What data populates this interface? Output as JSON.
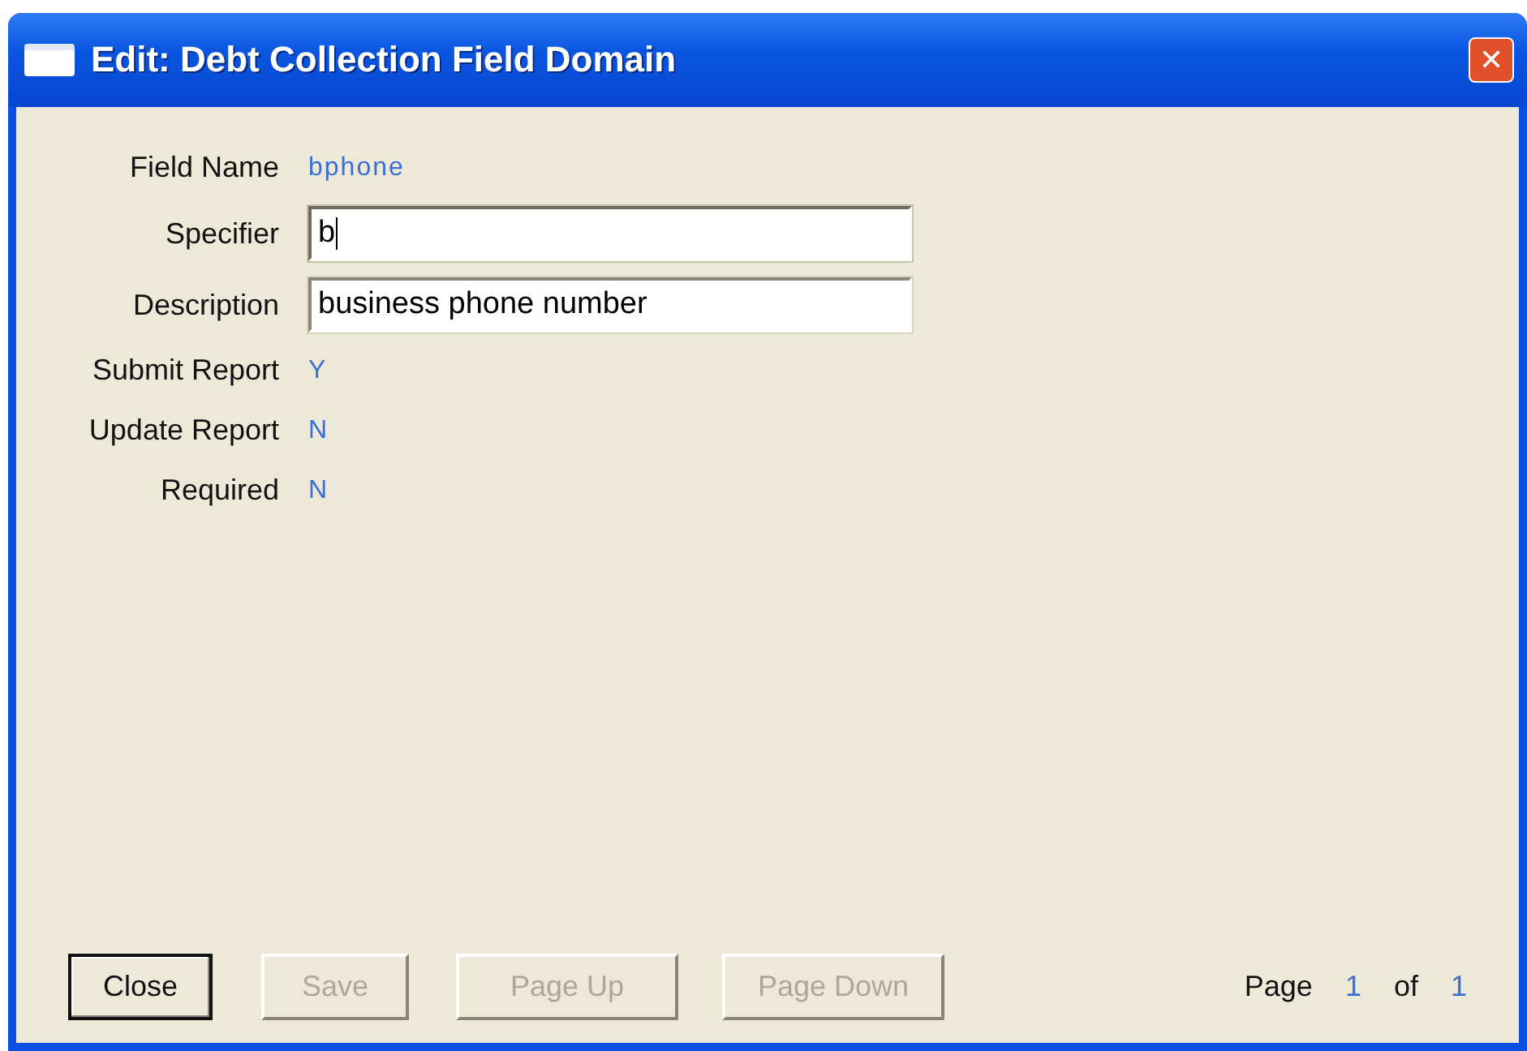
{
  "window": {
    "title": "Edit: Debt Collection Field Domain",
    "close": "✕"
  },
  "fields": [
    {
      "label": "Field Name",
      "kind": "text",
      "value": "bphone"
    },
    {
      "label": "Specifier",
      "kind": "input",
      "value": "b",
      "focused": true
    },
    {
      "label": "Description",
      "kind": "input",
      "value": "business phone number",
      "focused": false
    },
    {
      "label": "Submit Report",
      "kind": "text",
      "value": "Y"
    },
    {
      "label": "Update Report",
      "kind": "text",
      "value": "N"
    },
    {
      "label": "Required",
      "kind": "text",
      "value": "N"
    }
  ],
  "buttons": [
    {
      "label": "Close",
      "disabled": false,
      "default": true
    },
    {
      "label": "Save",
      "disabled": true,
      "default": false
    },
    {
      "label": "Page Up",
      "disabled": true,
      "default": false
    },
    {
      "label": "Page Down",
      "disabled": true,
      "default": false
    }
  ],
  "pager": {
    "label": "Page",
    "current": "1",
    "of": "of",
    "total": "1"
  }
}
